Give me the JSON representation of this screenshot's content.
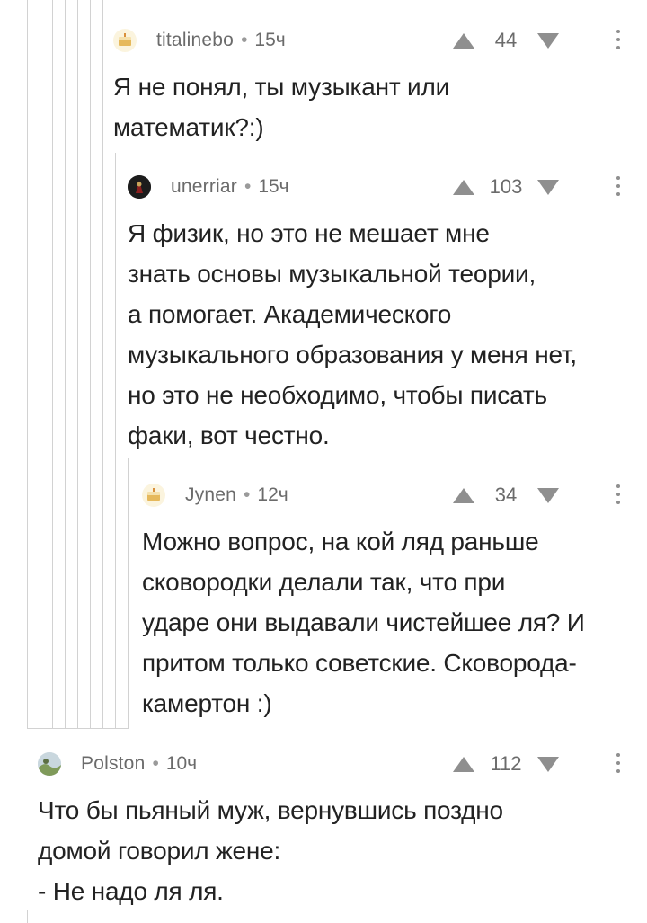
{
  "colors": {
    "text": "#222222",
    "meta": "#6b6b6b",
    "icon": "#8f8f8f",
    "thread_line": "#d2d2d2"
  },
  "comments": [
    {
      "author": "titalinebo",
      "time": "15ч",
      "votes": "44",
      "avatar_icon": "default-cake-avatar-icon",
      "lines": [
        "Я не понял, ты музыкант или",
        "математик?:)"
      ]
    },
    {
      "author": "unerriar",
      "time": "15ч",
      "votes": "103",
      "avatar_icon": "dark-user-avatar-icon",
      "lines": [
        "Я физик, но это не мешает мне",
        "знать основы музыкальной теории,",
        "а помогает. Академического",
        "музыкального образования у меня нет,",
        "но это не необходимо, чтобы писать",
        "факи, вот честно."
      ]
    },
    {
      "author": "Jynen",
      "time": "12ч",
      "votes": "34",
      "avatar_icon": "default-cake-avatar-icon",
      "lines": [
        "Можно вопрос, на кой ляд раньше",
        "сковородки делали так, что при",
        "ударе они выдавали чистейшее ля? И",
        "притом только советские. Сковорода-",
        "камертон :)"
      ]
    },
    {
      "author": "Polston",
      "time": "10ч",
      "votes": "112",
      "avatar_icon": "landscape-avatar-icon",
      "lines": [
        "Что бы пьяный муж, вернувшись поздно",
        "домой говорил жене:",
        "- Не надо ля ля."
      ]
    }
  ]
}
